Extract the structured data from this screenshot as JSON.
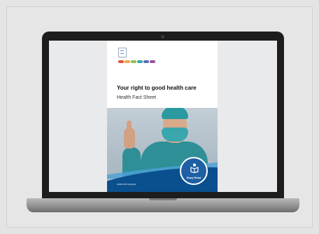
{
  "document": {
    "logo_text": "",
    "title": "Your right to good health care",
    "subtitle": "Health Fact Sheet",
    "footer_url": "www.cid.org.au",
    "badge_label": "Easy Read"
  },
  "colors": {
    "brand_blue": "#0a4f8e",
    "badge_blue": "#1f5fa3",
    "scrubs_teal": "#2f8f97",
    "logo_strip": [
      "#e94e3c",
      "#f2a541",
      "#8bc34a",
      "#3aa6ae",
      "#5b6fb5",
      "#9c4fa0"
    ]
  },
  "icons": {
    "badge_icon": "person-with-book-icon",
    "logo_icon": "cid-logo-icon"
  }
}
